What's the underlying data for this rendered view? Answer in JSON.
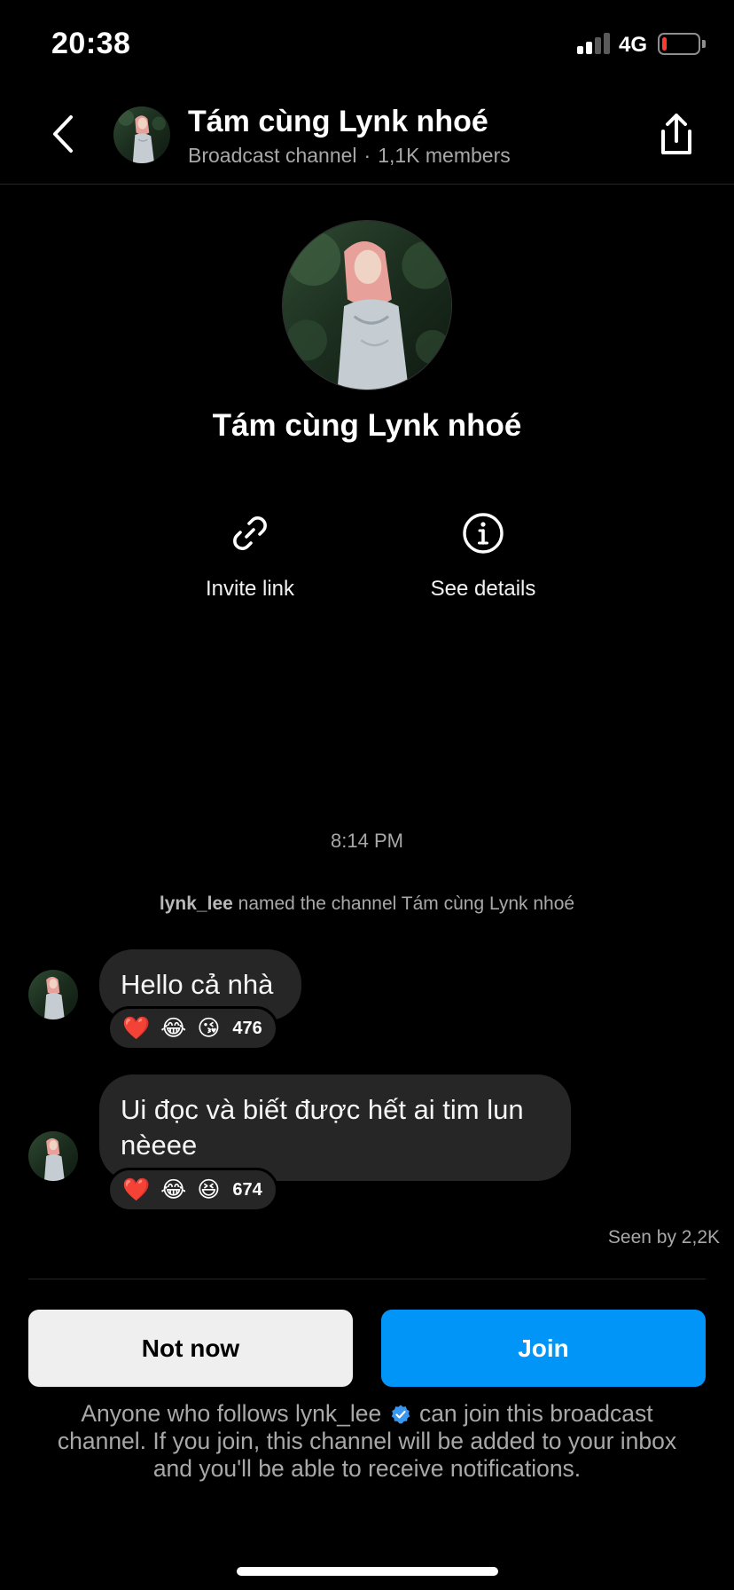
{
  "status_bar": {
    "time": "20:38",
    "network": "4G",
    "battery_level": 0.12
  },
  "header": {
    "title": "Tám cùng Lynk nhoé",
    "channel_type": "Broadcast channel",
    "members": "1,1K members"
  },
  "profile": {
    "name": "Tám cùng Lynk nhoé"
  },
  "actions": [
    {
      "label": "Invite link",
      "icon": "link-icon"
    },
    {
      "label": "See details",
      "icon": "info-icon"
    }
  ],
  "chat": {
    "timestamp": "8:14 PM",
    "system_note": {
      "username": "lynk_lee",
      "text": "named the channel Tám cùng Lynk nhoé"
    },
    "messages": [
      {
        "text": "Hello cả nhà",
        "reactions": [
          "❤️",
          "😂",
          "😘"
        ],
        "reaction_count": "476"
      },
      {
        "text": "Ui đọc và biết được hết ai tim lun nèeee",
        "reactions": [
          "❤️",
          "😂",
          "😆"
        ],
        "reaction_count": "674"
      }
    ],
    "seen": "Seen by 2,2K"
  },
  "buttons": {
    "not_now": "Not now",
    "join": "Join"
  },
  "footnote": {
    "before": "Anyone who follows lynk_lee",
    "after": "can join this broadcast channel. If you join, this channel will be added to your inbox and you'll be able to receive notifications."
  },
  "colors": {
    "background": "#000000",
    "bubble": "#262626",
    "primary": "#0095f6",
    "secondary_text": "#a8a8a8"
  }
}
